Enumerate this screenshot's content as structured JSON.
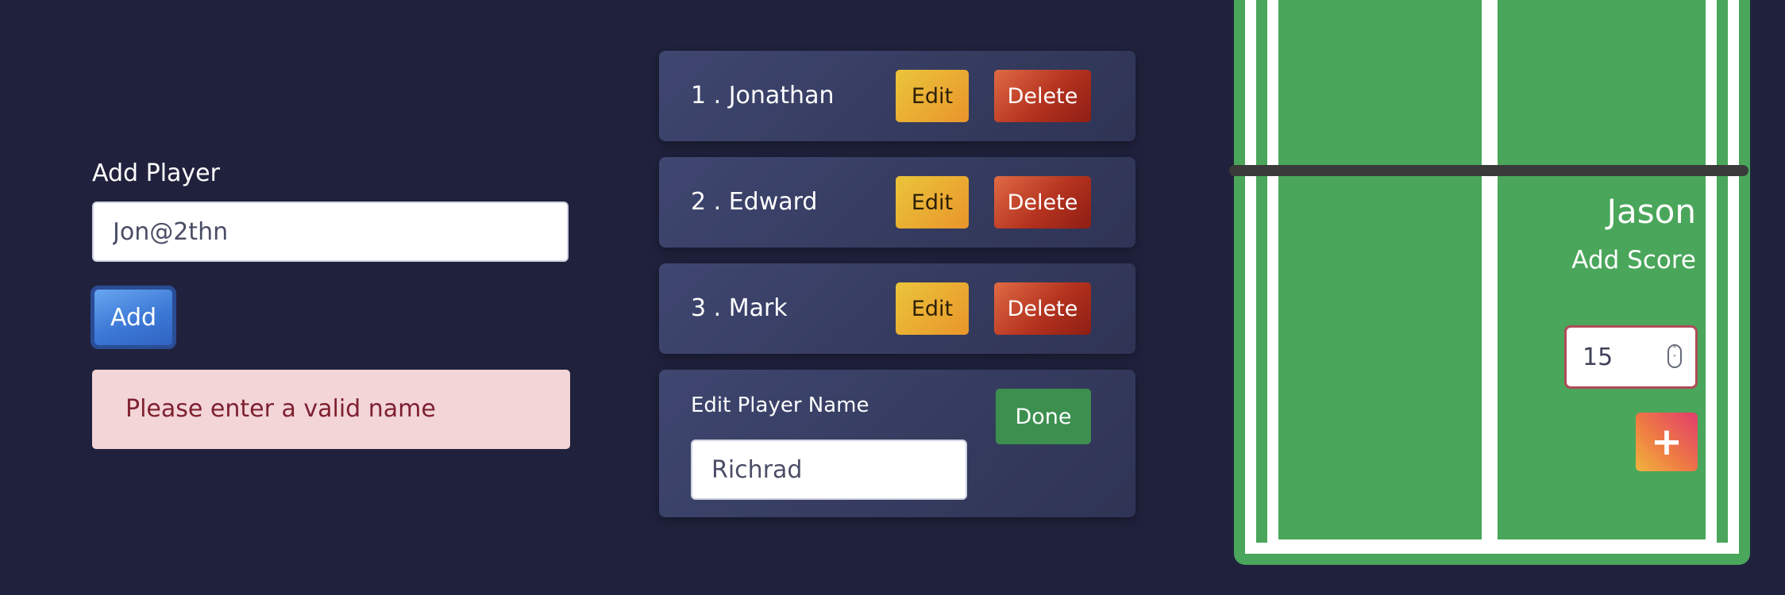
{
  "add_player": {
    "title": "Add Player",
    "input_value": "Jon@2thn",
    "add_label": "Add",
    "error_message": "Please enter a valid name"
  },
  "players": [
    {
      "label": "1 .  Jonathan",
      "edit_label": "Edit",
      "delete_label": "Delete"
    },
    {
      "label": "2 .  Edward",
      "edit_label": "Edit",
      "delete_label": "Delete"
    },
    {
      "label": "3 .  Mark",
      "edit_label": "Edit",
      "delete_label": "Delete"
    }
  ],
  "edit_player": {
    "label": "Edit Player Name",
    "input_value": "Richrad",
    "done_label": "Done"
  },
  "court": {
    "player_name": "Jason",
    "add_score_label": "Add Score",
    "score_value": "15",
    "plus_label": "+"
  },
  "colors": {
    "background": "#20223d",
    "card": "#3a4068",
    "court_green": "#4aa65a",
    "error_bg": "#f3d5d8",
    "error_text": "#7e2030"
  },
  "icons": {
    "plus": "plus-icon",
    "stepper": "number-stepper-icon"
  }
}
